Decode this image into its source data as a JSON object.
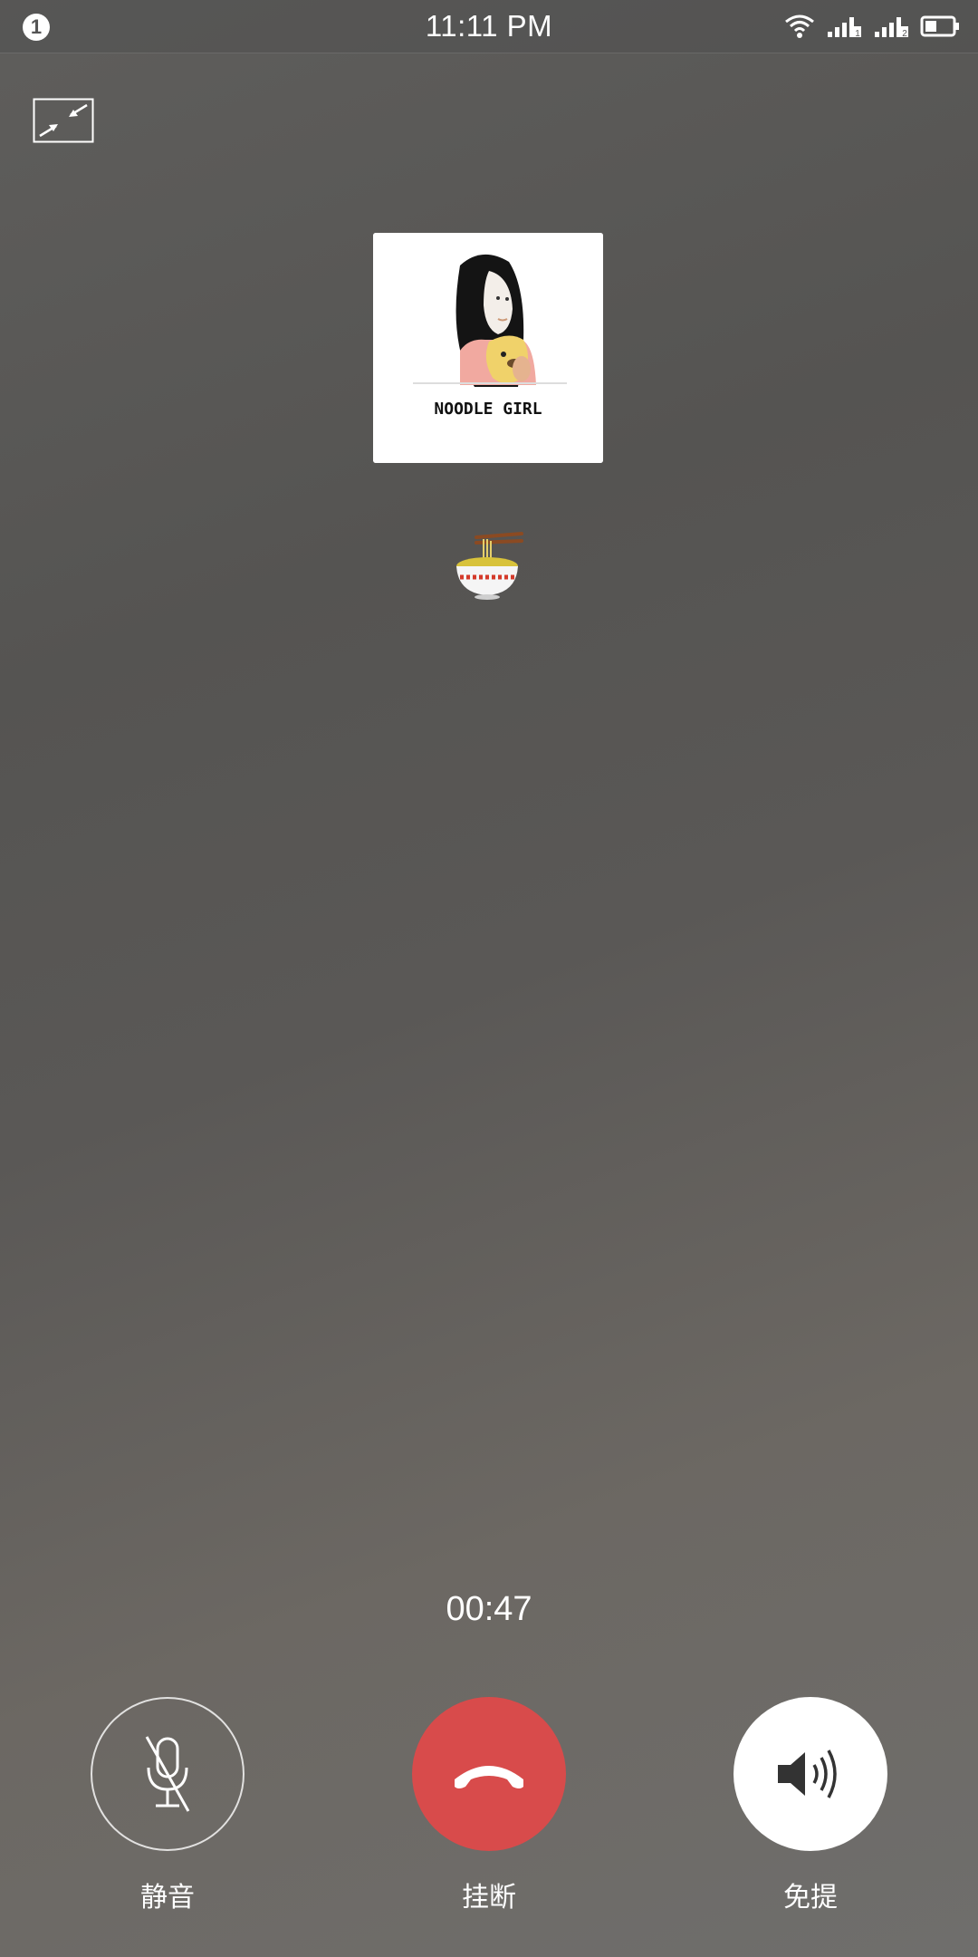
{
  "status_bar": {
    "notification_count": "1",
    "time": "11:11 PM",
    "icons": [
      "wifi-icon",
      "signal-sim1-icon",
      "signal-sim2-icon",
      "battery-icon"
    ]
  },
  "call": {
    "contact_avatar_text": "NOODLE GIRL",
    "contact_name": "🍜",
    "duration": "00:47"
  },
  "controls": {
    "mute_label": "静音",
    "hangup_label": "挂断",
    "speaker_label": "免提"
  },
  "colors": {
    "hangup": "#d84b4b",
    "speaker_bg": "#ffffff"
  }
}
